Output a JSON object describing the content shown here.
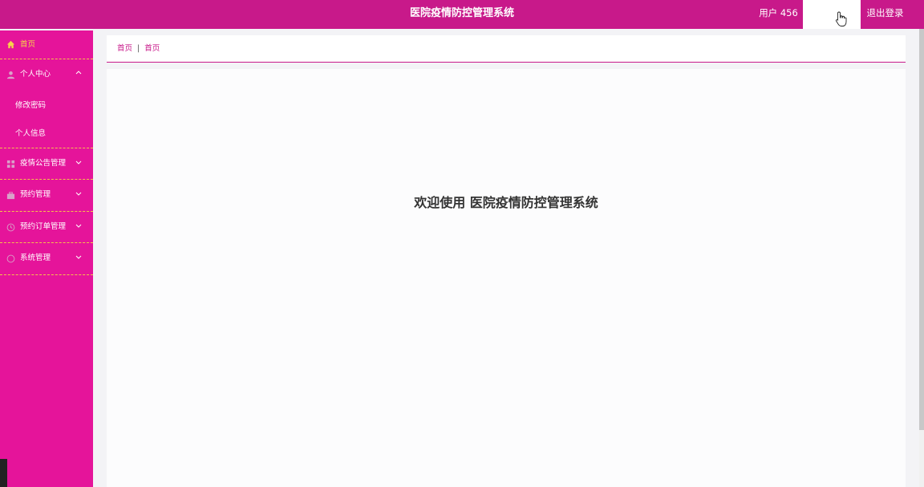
{
  "header": {
    "title": "医院疫情防控管理系统",
    "user_label": "用户 456",
    "front_label": "",
    "logout_label": "退出登录"
  },
  "sidebar": {
    "home": "首页",
    "personal_center": "个人中心",
    "personal_sub": [
      "修改密码",
      "个人信息"
    ],
    "epidemic_notice": "疫情公告管理",
    "appointment": "预约管理",
    "appointment_order": "预约订单管理",
    "system": "系统管理"
  },
  "breadcrumb": [
    "首页",
    "|",
    "首页"
  ],
  "main": {
    "welcome": "欢迎使用 医院疫情防控管理系统"
  },
  "colors": {
    "header_bg": "#c8198a",
    "sidebar_bg": "#e5149a",
    "active_menu": "#f7d34a"
  }
}
